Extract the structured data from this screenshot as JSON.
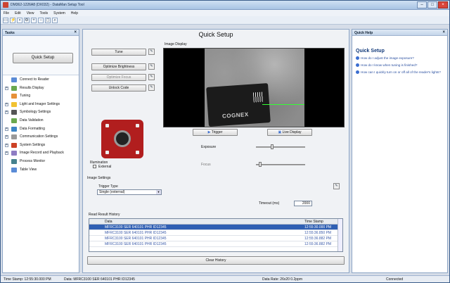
{
  "window": {
    "title": "DM362-1226A8 (DX032) - DataMan Setup Tool"
  },
  "menu": [
    "File",
    "Edit",
    "View",
    "Tools",
    "System",
    "Help"
  ],
  "tasks": {
    "header": "Tasks",
    "quick_setup_label": "Quick Setup",
    "items": [
      {
        "label": "Connect to Reader",
        "expand": "",
        "color": "#5a8bd6"
      },
      {
        "label": "Results Display",
        "expand": "+",
        "color": "#6aa84f"
      },
      {
        "label": "Tuning",
        "expand": "",
        "color": "#e69138"
      },
      {
        "label": "Light and Imager Settings",
        "expand": "+",
        "color": "#f1c232"
      },
      {
        "label": "Symbology Settings",
        "expand": "+",
        "color": "#555555"
      },
      {
        "label": "Data Validation",
        "expand": "",
        "color": "#6aa84f"
      },
      {
        "label": "Data Formatting",
        "expand": "+",
        "color": "#3d85c6"
      },
      {
        "label": "Communication Settings",
        "expand": "+",
        "color": "#999999"
      },
      {
        "label": "System Settings",
        "expand": "+",
        "color": "#cc4125"
      },
      {
        "label": "Image Record and Playback",
        "expand": "+",
        "color": "#8e7cc3"
      },
      {
        "label": "Process Monitor",
        "expand": "",
        "color": "#45818e"
      },
      {
        "label": "Table View",
        "expand": "",
        "color": "#5a8bd6"
      }
    ]
  },
  "main": {
    "title": "Quick Setup",
    "buttons": {
      "tune": "Tune",
      "optimize_brightness": "Optimize Brightness",
      "optimize_focus": "Optimize Focus",
      "unlock_code": "Unlock Code",
      "trigger": "Trigger",
      "live_display": "Live Display",
      "clear_history": "Clear History"
    },
    "image_display_label": "Image Display",
    "card_logo": "COGNEX",
    "illumination_label": "Illumination",
    "external_label": "External",
    "exposure_label": "Exposure",
    "exposure_level": 0.3,
    "focus_label": "Focus",
    "focus_level": 0.05,
    "image_settings_label": "Image Settings",
    "trigger_type_label": "Trigger Type",
    "trigger_type_value": "Single (external)",
    "timeout_label": "Timeout (ms)",
    "timeout_value": "2000",
    "history": {
      "label": "Read Result History",
      "columns": [
        "Data",
        "Time Stamp"
      ],
      "rows": [
        {
          "data": "MFRC3100 SER 640101 PHR ID12345",
          "time": "12:55:30.000 PM",
          "selected": true
        },
        {
          "data": "MFRC3100 SER 640101 PHR ID12345",
          "time": "12:55:36.850 PM",
          "selected": false
        },
        {
          "data": "MFRC3100 SER 640101 PHR ID12345",
          "time": "12:55:36.882 PM",
          "selected": false
        },
        {
          "data": "MFRC3100 SER 640101 PHR ID12345",
          "time": "12:55:36.882 PM",
          "selected": false
        }
      ]
    }
  },
  "help": {
    "header": "Quick Help",
    "title": "Quick Setup",
    "links": [
      "How do I adjust the image exposure?",
      "How do I know when tuning is finished?",
      "How can I quickly turn on or off all of the reader's lights?"
    ]
  },
  "status": {
    "time_stamp": "Time Stamp: 12:55:30.000 PM",
    "data": "Data: MFRC3100 SER 640101 PHR ID12345",
    "data_rate": "Data Rate: 26x20 0.2ppm",
    "connection": "Connected"
  }
}
